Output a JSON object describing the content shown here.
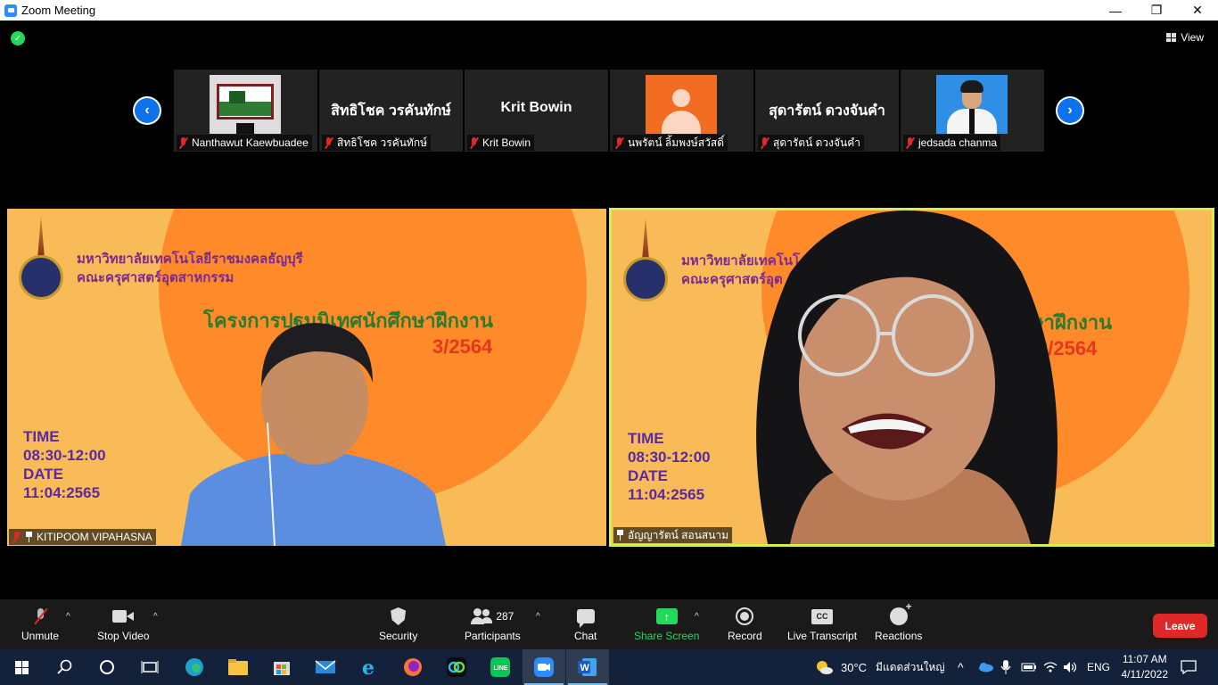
{
  "window": {
    "title": "Zoom Meeting",
    "controls": [
      "—",
      "❐",
      "✕"
    ]
  },
  "topbar": {
    "view_label": "View"
  },
  "thumbnails": [
    {
      "name": "Nanthawut Kaewbuadee",
      "display_name": "",
      "muted": true
    },
    {
      "name": "สิทธิโชค วรคันทักษ์",
      "display_name": "สิทธิโชค วรคันทักษ์",
      "muted": true
    },
    {
      "name": "Krit Bowin",
      "display_name": "Krit Bowin",
      "muted": true
    },
    {
      "name": "นพรัตน์ ลิ้มพงษ์สวัสดิ์",
      "display_name": "",
      "muted": true
    },
    {
      "name": "สุดารัตน์ ดวงจันคำ",
      "display_name": "สุดารัตน์ ดวงจันคำ",
      "muted": true
    },
    {
      "name": "jedsada chanma",
      "display_name": "",
      "muted": true
    }
  ],
  "slide": {
    "university": "มหาวิทยาลัยเทคโนโลยีราชมงคลธัญบุรี",
    "faculty": "คณะครุศาสตร์อุตสาหกรรม",
    "project": "โครงการปฐมนิเทศนักศึกษาฝึกงาน",
    "term": "3/2564",
    "time_label": "TIME",
    "time_value": "08:30-12:00",
    "date_label": "DATE",
    "date_value": "11:04:2565"
  },
  "right_slide": {
    "university": "มหาวิทยาลัยเทคโนโ",
    "faculty": "คณะครุศาสตร์อุต",
    "project": "ษาฝึกงาน",
    "term": "3/2564"
  },
  "videos": [
    {
      "name": "KITIPOOM VIPAHASNA",
      "muted": true,
      "pinned": true
    },
    {
      "name": "อัญญารัตน์ สอนสนาม",
      "muted": false,
      "pinned": true
    }
  ],
  "toolbar": {
    "unmute": "Unmute",
    "stop_video": "Stop Video",
    "security": "Security",
    "participants": "Participants",
    "participant_count": "287",
    "chat": "Chat",
    "share_screen": "Share Screen",
    "record": "Record",
    "live_transcript": "Live Transcript",
    "cc_label": "CC",
    "reactions": "Reactions",
    "leave": "Leave"
  },
  "taskbar": {
    "weather_temp": "30°C",
    "weather_desc": "มีแดดส่วนใหญ่",
    "language": "ENG",
    "time": "11:07 AM",
    "date": "4/11/2022"
  },
  "colors": {
    "zoom_blue": "#0e72ed",
    "share_green": "#23d959",
    "leave_red": "#e02828",
    "active_speaker_border": "#d4f04f",
    "slide_bg": "#f8bb58",
    "slide_sun": "#ff8a2a"
  }
}
